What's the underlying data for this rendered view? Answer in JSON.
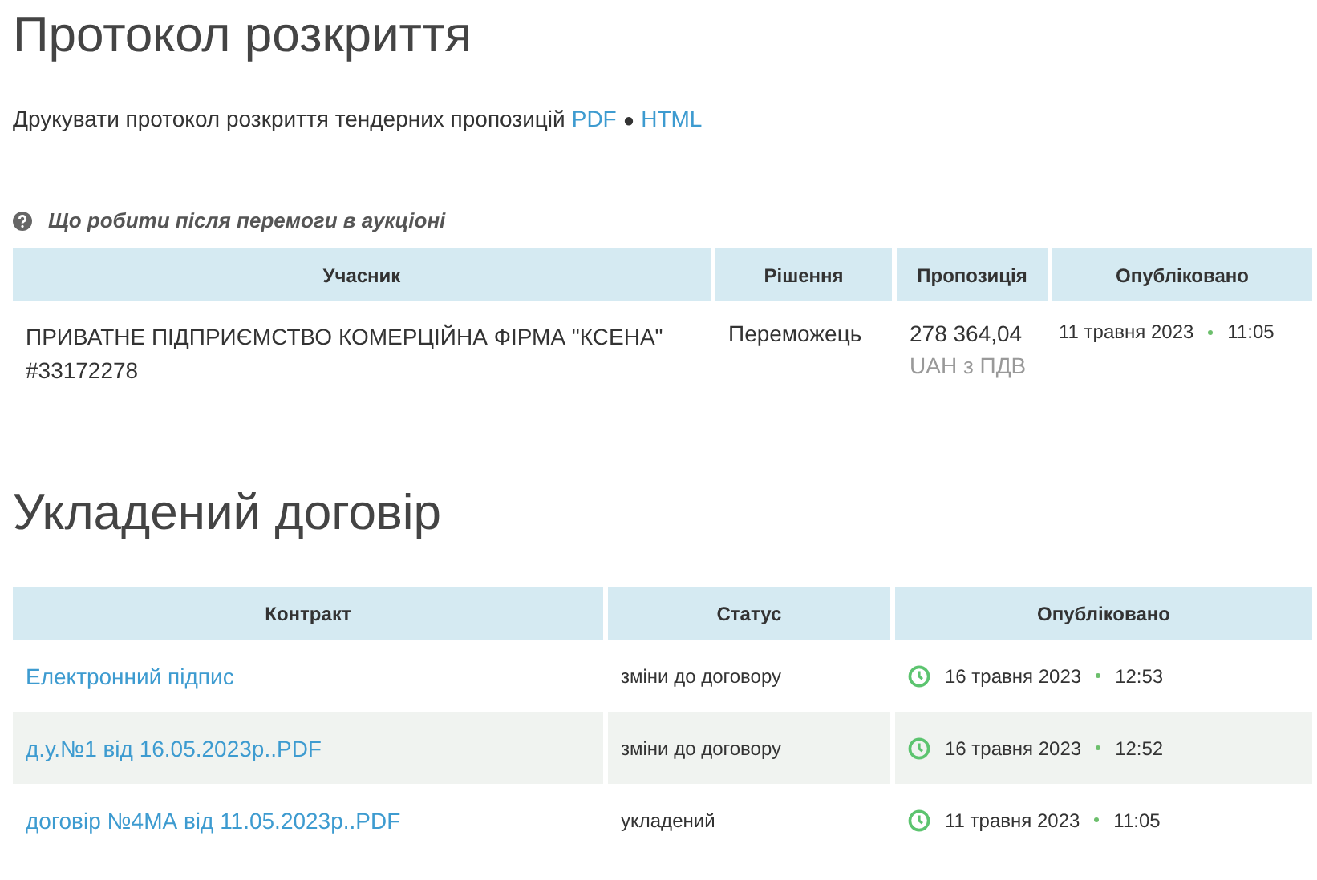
{
  "protocol": {
    "title": "Протокол розкриття",
    "print_text": "Друкувати протокол розкриття тендерних пропозицій",
    "links": [
      {
        "label": "PDF"
      },
      {
        "label": "HTML"
      }
    ],
    "link_separator": "●"
  },
  "help_link": "Що робити після перемоги в аукціоні",
  "bids_table": {
    "columns": [
      "Учасник",
      "Рішення",
      "Пропозиція",
      "Опубліковано"
    ],
    "rows": [
      {
        "participant": "ПРИВАТНЕ ПІДПРИЄМСТВО КОМЕРЦІЙНА ФІРМА \"КСЕНА\" #33172278",
        "decision": "Переможець",
        "amount": "278 364,04",
        "amount_note": "UAH з ПДВ",
        "date": "11 травня 2023",
        "time": "11:05"
      }
    ]
  },
  "contract": {
    "title": "Укладений договір",
    "columns": [
      "Контракт",
      "Статус",
      "Опубліковано"
    ],
    "rows": [
      {
        "document": "Електронний підпис",
        "status": "зміни до договору",
        "date": "16 травня 2023",
        "time": "12:53"
      },
      {
        "document": "д.у.№1 від 16.05.2023р..PDF",
        "status": "зміни до договору",
        "date": "16 травня 2023",
        "time": "12:52"
      },
      {
        "document": "договір №4МА від 11.05.2023р..PDF",
        "status": "укладений",
        "date": "11 травня 2023",
        "time": "11:05"
      }
    ]
  }
}
